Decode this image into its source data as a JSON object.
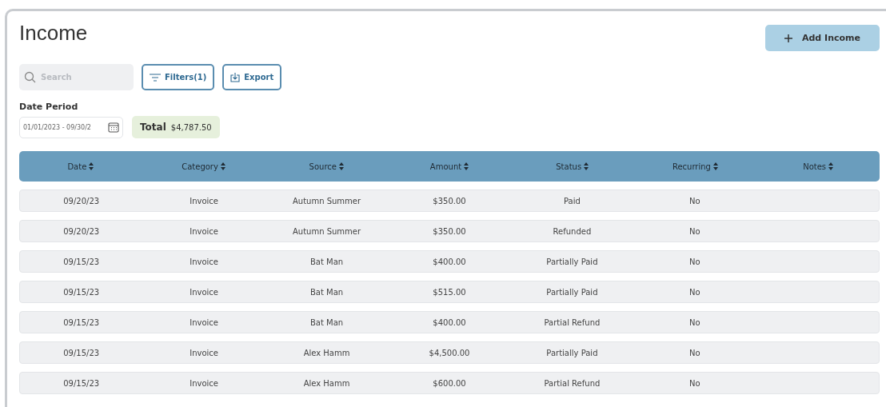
{
  "title": "Income",
  "add_button": {
    "label": "Add Income"
  },
  "search": {
    "placeholder": "Search"
  },
  "filters_button": {
    "label": "Filters(1)"
  },
  "export_button": {
    "label": "Export"
  },
  "date_period": {
    "label": "Date Period",
    "value": "01/01/2023 - 09/30/2"
  },
  "total": {
    "label": "Total",
    "value": "$4,787.50"
  },
  "table": {
    "columns": [
      "Date",
      "Category",
      "Source",
      "Amount",
      "Status",
      "Recurring",
      "Notes"
    ],
    "rows": [
      [
        "09/20/23",
        "Invoice",
        "Autumn Summer",
        "$350.00",
        "Paid",
        "No",
        ""
      ],
      [
        "09/20/23",
        "Invoice",
        "Autumn Summer",
        "$350.00",
        "Refunded",
        "No",
        ""
      ],
      [
        "09/15/23",
        "Invoice",
        "Bat Man",
        "$400.00",
        "Partially Paid",
        "No",
        ""
      ],
      [
        "09/15/23",
        "Invoice",
        "Bat Man",
        "$515.00",
        "Partially Paid",
        "No",
        ""
      ],
      [
        "09/15/23",
        "Invoice",
        "Bat Man",
        "$400.00",
        "Partial Refund",
        "No",
        ""
      ],
      [
        "09/15/23",
        "Invoice",
        "Alex Hamm",
        "$4,500.00",
        "Partially Paid",
        "No",
        ""
      ],
      [
        "09/15/23",
        "Invoice",
        "Alex Hamm",
        "$600.00",
        "Partial Refund",
        "No",
        ""
      ]
    ]
  }
}
